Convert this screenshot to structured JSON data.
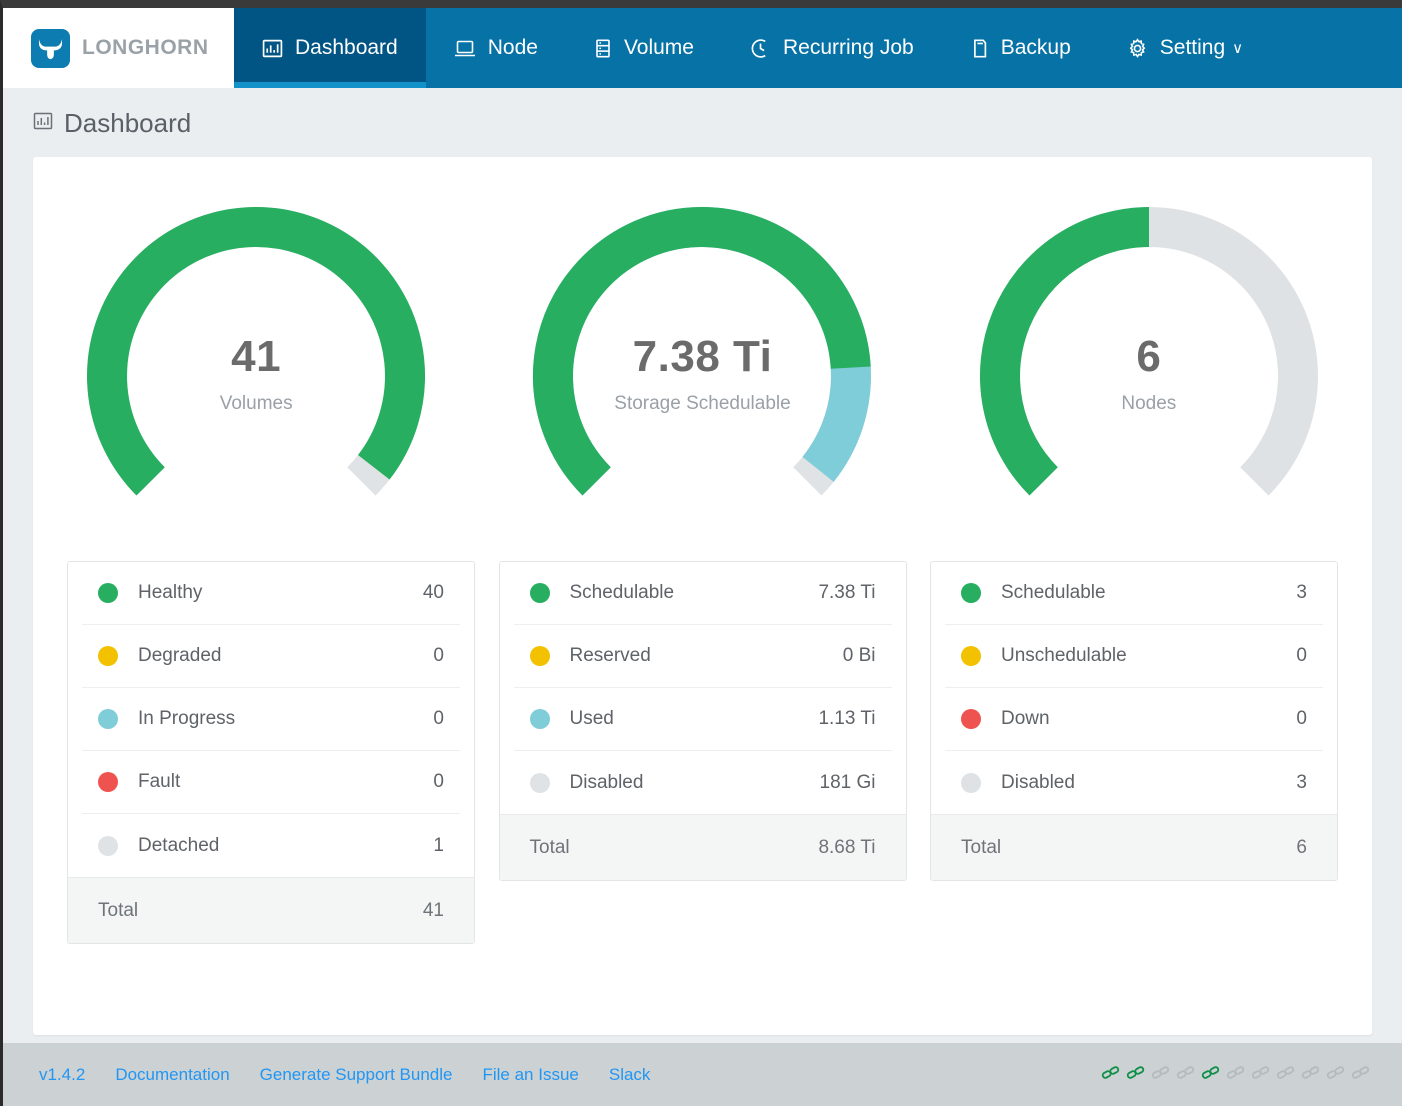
{
  "brand": {
    "name": "LONGHORN",
    "logo_icon": "longhorn-bull-icon",
    "logo_bg": "#0d7cb0"
  },
  "navbar": {
    "bg": "#0672a5",
    "active_bg": "#015584",
    "underline": "#1292c9",
    "items": [
      {
        "label": "Dashboard",
        "icon": "bar-chart-icon",
        "active": true
      },
      {
        "label": "Node",
        "icon": "server-node-icon",
        "active": false
      },
      {
        "label": "Volume",
        "icon": "volume-stack-icon",
        "active": false
      },
      {
        "label": "Recurring Job",
        "icon": "clock-icon",
        "active": false
      },
      {
        "label": "Backup",
        "icon": "backup-copy-icon",
        "active": false
      },
      {
        "label": "Setting",
        "icon": "gear-icon",
        "active": false,
        "caret": "∨"
      }
    ]
  },
  "page": {
    "title": "Dashboard",
    "icon": "bar-chart-icon"
  },
  "chart_data": [
    {
      "type": "pie",
      "title": "Volumes",
      "center_value": "41",
      "center_label": "Volumes",
      "gauge_sweep_degrees": 270,
      "total": 41,
      "categories": [
        "Healthy",
        "Degraded",
        "In Progress",
        "Fault",
        "Detached"
      ],
      "values": [
        40,
        0,
        0,
        0,
        1
      ],
      "colors": [
        "#27ae60",
        "#f2c200",
        "#7fcdd8",
        "#ef5350",
        "#e0e3e5"
      ],
      "legend_position": "below",
      "total_label": "Total",
      "total_value": "41"
    },
    {
      "type": "pie",
      "title": "Storage Schedulable",
      "center_value": "7.38 Ti",
      "center_label": "Storage Schedulable",
      "gauge_sweep_degrees": 270,
      "total": 8.68,
      "unit": "Ti",
      "categories": [
        "Schedulable",
        "Reserved",
        "Used",
        "Disabled"
      ],
      "values": [
        7.38,
        0,
        1.13,
        0.177
      ],
      "display_values": [
        "7.38 Ti",
        "0 Bi",
        "1.13 Ti",
        "181 Gi"
      ],
      "colors": [
        "#27ae60",
        "#f2c200",
        "#7fcdd8",
        "#e0e3e5"
      ],
      "legend_position": "below",
      "total_label": "Total",
      "total_value": "8.68 Ti"
    },
    {
      "type": "pie",
      "title": "Nodes",
      "center_value": "6",
      "center_label": "Nodes",
      "gauge_sweep_degrees": 270,
      "total": 6,
      "categories": [
        "Schedulable",
        "Unschedulable",
        "Down",
        "Disabled"
      ],
      "values": [
        3,
        0,
        0,
        3
      ],
      "colors": [
        "#27ae60",
        "#f2c200",
        "#ef5350",
        "#dfe2e4"
      ],
      "legend_position": "below",
      "total_label": "Total",
      "total_value": "6"
    }
  ],
  "panels": [
    {
      "gauge": {
        "value": "41",
        "label": "Volumes"
      },
      "rows": [
        {
          "label": "Healthy",
          "value": "40",
          "color": "#27ae60"
        },
        {
          "label": "Degraded",
          "value": "0",
          "color": "#f2c200"
        },
        {
          "label": "In Progress",
          "value": "0",
          "color": "#7fcdd8"
        },
        {
          "label": "Fault",
          "value": "0",
          "color": "#ef5350"
        },
        {
          "label": "Detached",
          "value": "1",
          "color": "#e0e3e5"
        }
      ],
      "total": {
        "label": "Total",
        "value": "41"
      }
    },
    {
      "gauge": {
        "value": "7.38 Ti",
        "label": "Storage Schedulable"
      },
      "rows": [
        {
          "label": "Schedulable",
          "value": "7.38 Ti",
          "color": "#27ae60"
        },
        {
          "label": "Reserved",
          "value": "0 Bi",
          "color": "#f2c200"
        },
        {
          "label": "Used",
          "value": "1.13 Ti",
          "color": "#7fcdd8"
        },
        {
          "label": "Disabled",
          "value": "181 Gi",
          "color": "#e0e3e5"
        }
      ],
      "total": {
        "label": "Total",
        "value": "8.68 Ti"
      }
    },
    {
      "gauge": {
        "value": "6",
        "label": "Nodes"
      },
      "rows": [
        {
          "label": "Schedulable",
          "value": "3",
          "color": "#27ae60"
        },
        {
          "label": "Unschedulable",
          "value": "0",
          "color": "#f2c200"
        },
        {
          "label": "Down",
          "value": "0",
          "color": "#ef5350"
        },
        {
          "label": "Disabled",
          "value": "3",
          "color": "#dfe2e4"
        }
      ],
      "total": {
        "label": "Total",
        "value": "6"
      }
    }
  ],
  "footer": {
    "links": [
      {
        "label": "v1.4.2"
      },
      {
        "label": "Documentation"
      },
      {
        "label": "Generate Support Bundle"
      },
      {
        "label": "File an Issue"
      },
      {
        "label": "Slack"
      }
    ],
    "status_icons": {
      "icon": "chain-link-icon",
      "count": 11,
      "active_color": "#0f8f47",
      "inactive_color": "#b4bbbf",
      "states": [
        true,
        true,
        false,
        false,
        true,
        false,
        false,
        false,
        false,
        false,
        false
      ]
    }
  }
}
